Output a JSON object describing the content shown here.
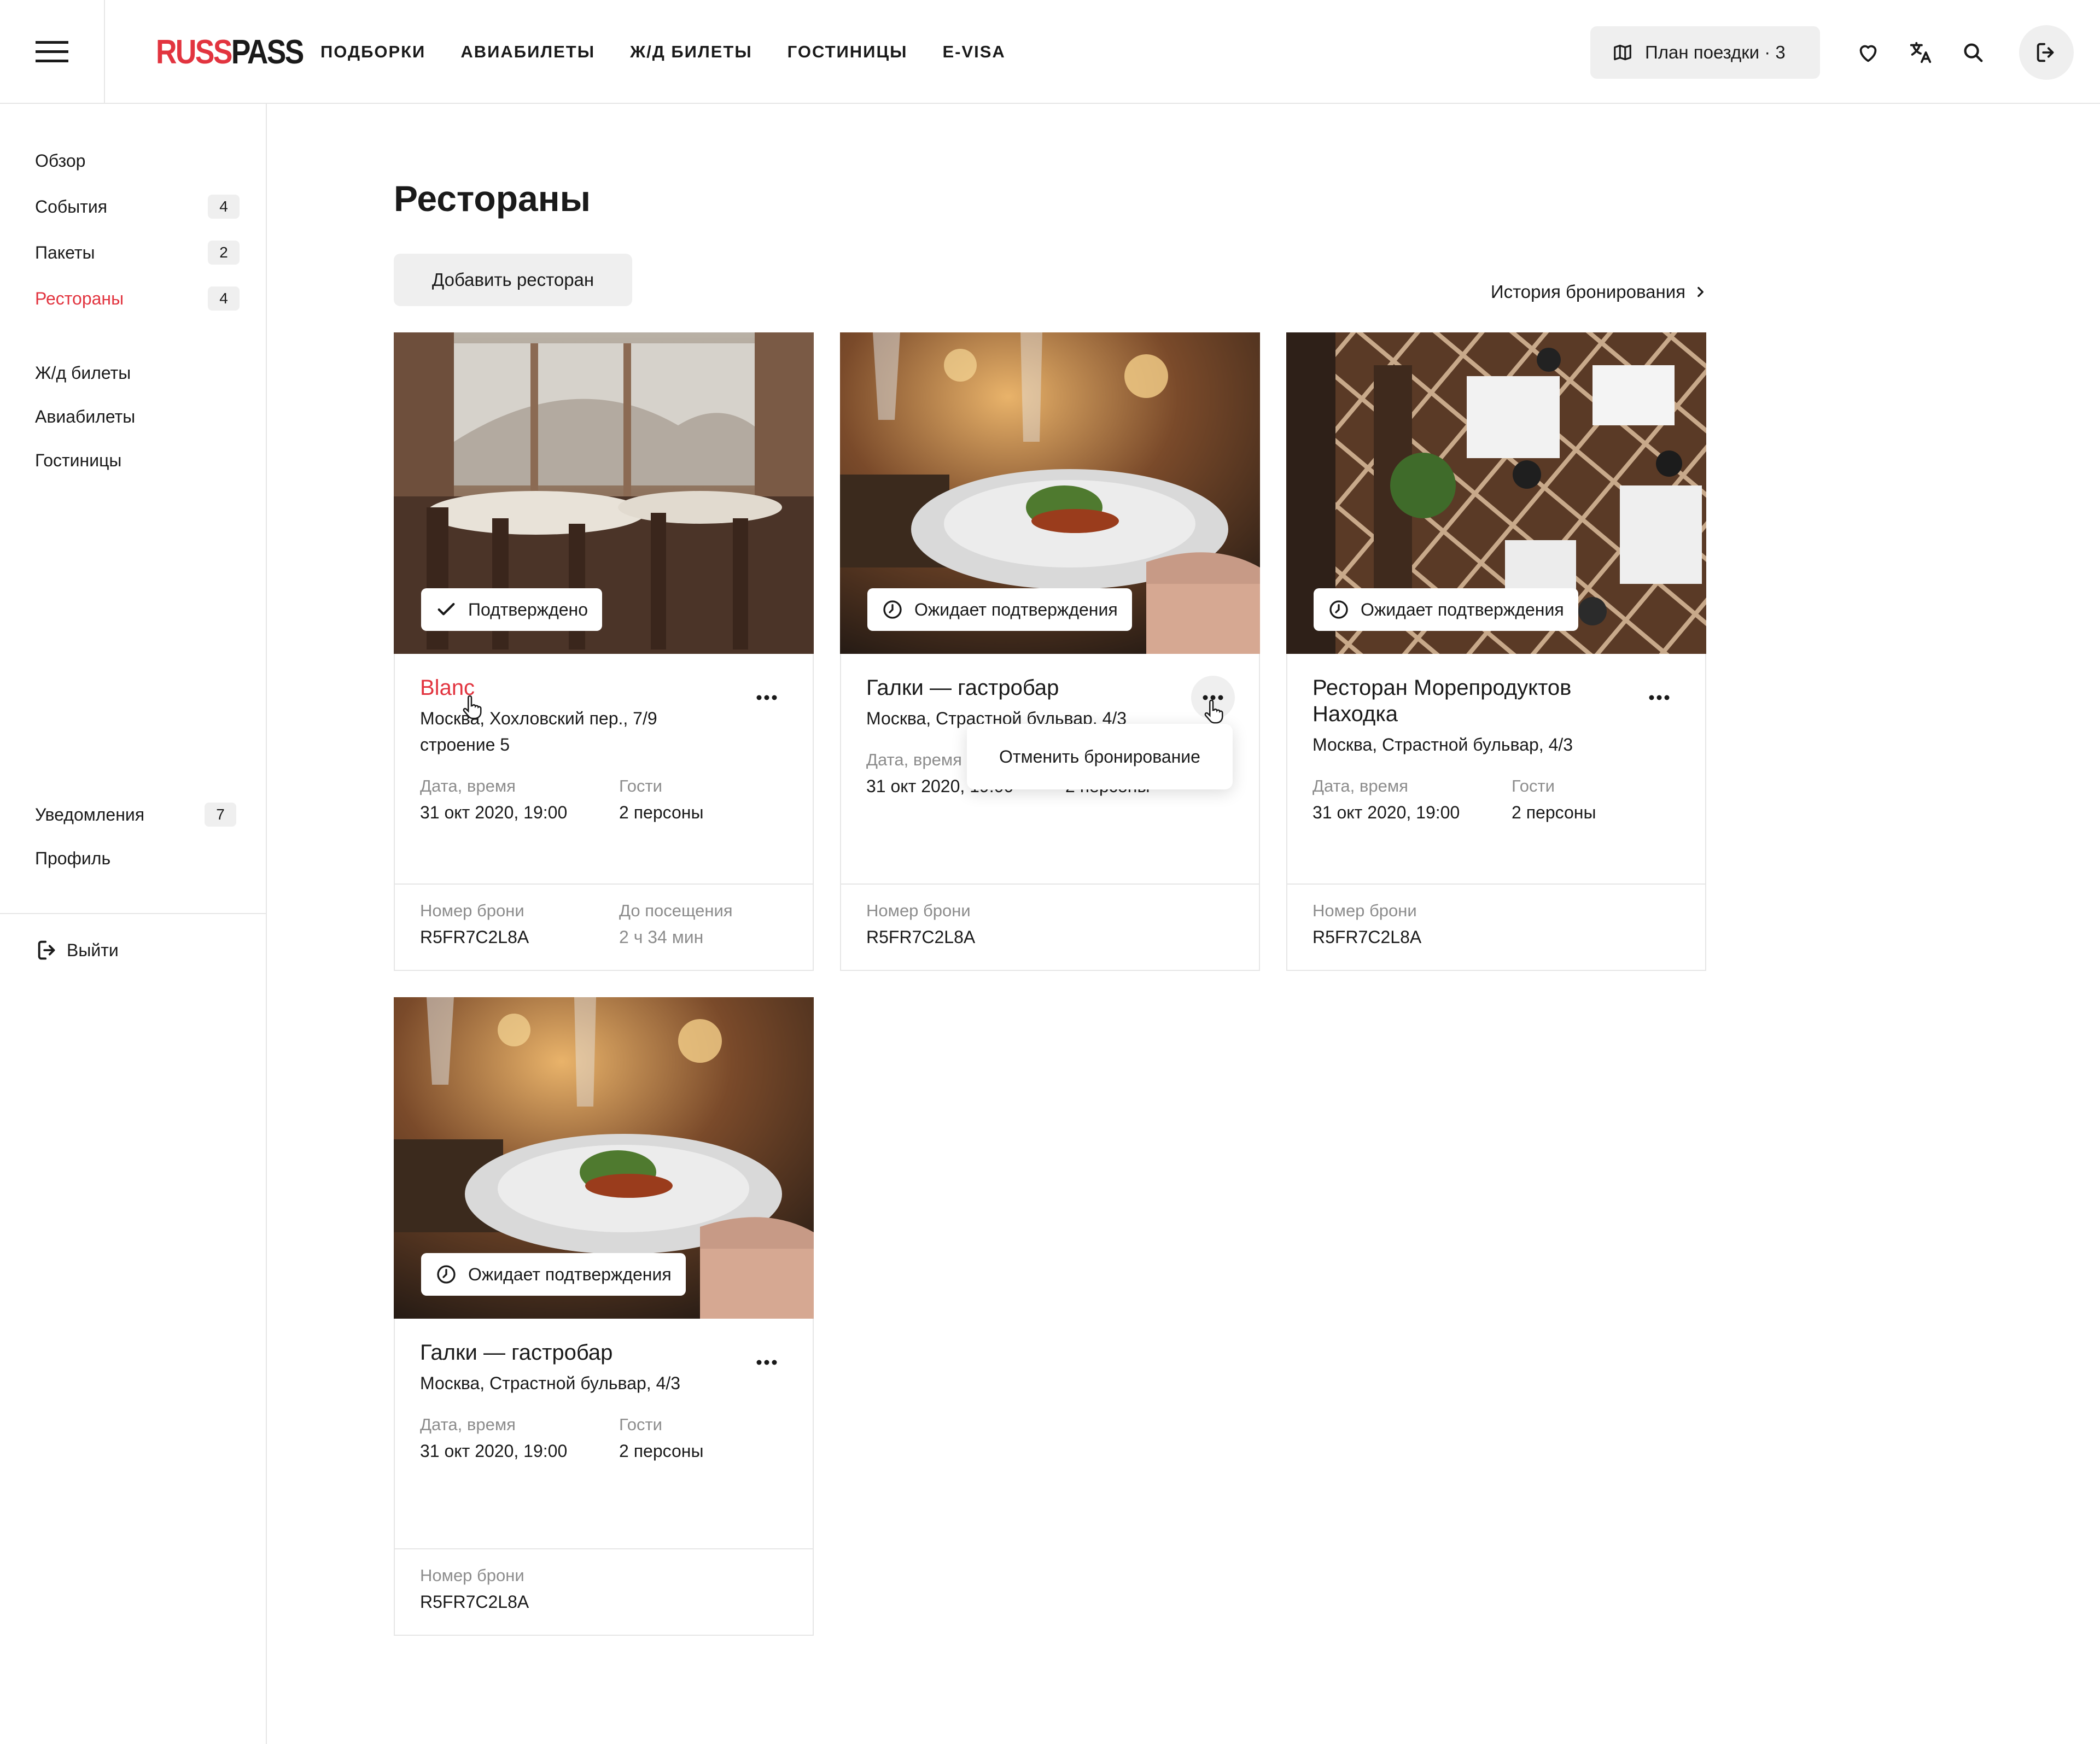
{
  "header": {
    "logo_left": "RUSS",
    "logo_right": "PASS",
    "nav": [
      "ПОДБОРКИ",
      "АВИАБИЛЕТЫ",
      "Ж/Д БИЛЕТЫ",
      "ГОСТИНИЦЫ",
      "E-VISA"
    ],
    "trip_plan": "План поездки · 3"
  },
  "sidebar": {
    "items": [
      {
        "label": "Обзор",
        "badge": ""
      },
      {
        "label": "События",
        "badge": "4"
      },
      {
        "label": "Пакеты",
        "badge": "2"
      },
      {
        "label": "Рестораны",
        "badge": "4"
      },
      {
        "label": "Ж/д билеты",
        "badge": ""
      },
      {
        "label": "Авиабилеты",
        "badge": ""
      },
      {
        "label": "Гостиницы",
        "badge": ""
      },
      {
        "label": "Уведомления",
        "badge": "7"
      },
      {
        "label": "Профиль",
        "badge": ""
      }
    ],
    "logout": "Выйти"
  },
  "main": {
    "title": "Рестораны",
    "add_button": "Добавить ресторан",
    "history_link": "История бронирования"
  },
  "labels": {
    "date_time": "Дата, время",
    "guests": "Гости",
    "booking_number": "Номер брони",
    "until_visit": "До посещения"
  },
  "cards": [
    {
      "status": "Подтверждено",
      "name": "Blanc",
      "address_line1": "Москва, Хохловский пер., 7/9",
      "address_line2": "строение 5",
      "date": "31 окт 2020, 19:00",
      "guests": "2 персоны",
      "booking": "R5FR7C2L8A",
      "until": "2 ч 34 мин"
    },
    {
      "status": "Ожидает подтверждения",
      "name": "Галки — гастробар",
      "address_line1": "Москва, Страстной бульвар, 4/3",
      "date": "31 окт 2020, 19:00",
      "guests": "2 персоны",
      "booking": "R5FR7C2L8A"
    },
    {
      "status": "Ожидает подтверждения",
      "name": "Ресторан Морепродуктов Находка",
      "address_line1": "Москва, Страстной бульвар, 4/3",
      "date": "31 окт 2020, 19:00",
      "guests": "2 персоны",
      "booking": "R5FR7C2L8A"
    },
    {
      "status": "Ожидает подтверждения",
      "name": "Галки — гастробар",
      "address_line1": "Москва, Страстной бульвар, 4/3",
      "date": "31 окт 2020, 19:00",
      "guests": "2 персоны",
      "booking": "R5FR7C2L8A"
    }
  ],
  "dropdown": {
    "cancel": "Отменить бронирование"
  },
  "colors": {
    "accent": "#e2343f",
    "muted_bg": "#efefef",
    "border": "#e6e6e6",
    "muted_text": "#8c8c8c"
  }
}
